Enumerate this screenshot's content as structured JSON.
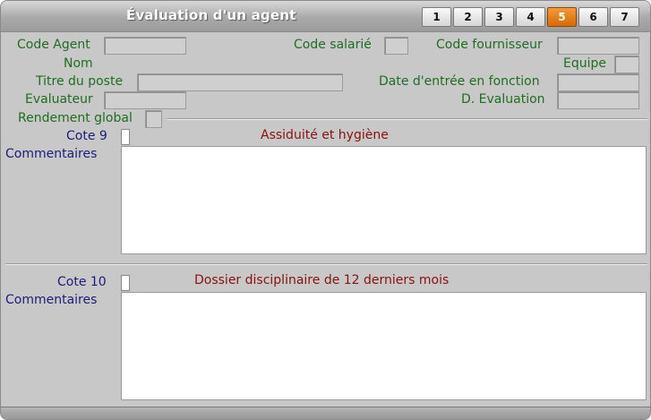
{
  "window": {
    "title": "Évaluation d'un agent"
  },
  "tabs": [
    {
      "label": "1",
      "active": false
    },
    {
      "label": "2",
      "active": false
    },
    {
      "label": "3",
      "active": false
    },
    {
      "label": "4",
      "active": false
    },
    {
      "label": "5",
      "active": true
    },
    {
      "label": "6",
      "active": false
    },
    {
      "label": "7",
      "active": false
    }
  ],
  "labels": {
    "code_agent": "Code Agent",
    "code_salarie": "Code salarié",
    "code_fournisseur": "Code fournisseur",
    "nom": "Nom",
    "equipe": "Equipe",
    "titre_poste": "Titre du poste",
    "date_entree": "Date d'entrée en fonction",
    "evaluateur": "Evaluateur",
    "d_evaluation": "D. Evaluation",
    "rendement_global": "Rendement global"
  },
  "section1": {
    "cote_label": "Cote 9",
    "title": "Assiduité et hygiène",
    "comments_label": "Commentaires"
  },
  "section2": {
    "cote_label": "Cote 10",
    "title": "Dossier disciplinaire de 12 derniers mois",
    "comments_label": "Commentaires"
  },
  "colors": {
    "label_green": "#1e6e1e",
    "label_navy": "#1c1c7c",
    "section_red": "#8a1010",
    "active_tab": "#e07a10"
  }
}
